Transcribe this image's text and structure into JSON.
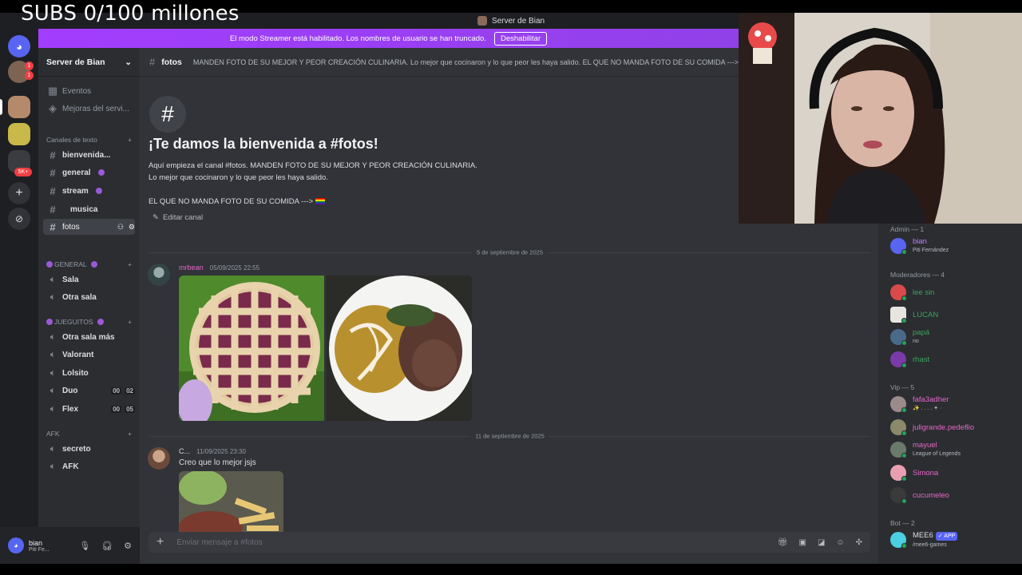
{
  "overlay": {
    "title": "SUBS 0/100 millones"
  },
  "window": {
    "title": "Server de Bian"
  },
  "streamer_bar": {
    "message": "El modo Streamer está habilitado. Los nombres de usuario se han truncado.",
    "button": "Deshabilitar"
  },
  "rail": {
    "badge_1": "1",
    "badge_2": "1",
    "badge_3": "5K+"
  },
  "server": {
    "name": "Server de Bian"
  },
  "sidebar": {
    "top_items": [
      "Eventos",
      "Mejoras del servi..."
    ],
    "text_category": "Canales de texto",
    "text_channels": [
      "bienvenida...",
      "general",
      "stream",
      "musica",
      "fotos"
    ],
    "cat_general": "GENERAL",
    "general_voice": [
      "Sala",
      "Otra sala"
    ],
    "cat_jueguitos": "JUEGUITOS",
    "jueguitos_voice": [
      "Otra sala más",
      "Valorant",
      "Lolsito",
      "Duo",
      "Flex"
    ],
    "duo_counts": [
      "00",
      "02"
    ],
    "flex_counts": [
      "00",
      "05"
    ],
    "cat_afk": "AFK",
    "afk_voice": [
      "secreto",
      "AFK"
    ]
  },
  "user_panel": {
    "name": "bian",
    "status": "Piti Fe..."
  },
  "channel": {
    "name": "fotos",
    "topic": "MANDEN FOTO DE SU MEJOR Y PEOR CREACIÓN CULINARIA. Lo mejor que cocinaron y lo que peor les haya salido. EL QUE NO MANDA FOTO DE SU COMIDA --->"
  },
  "welcome": {
    "hash": "#",
    "title": "¡Te damos la bienvenida a #fotos!",
    "line1": "Aquí empieza el canal #fotos. MANDEN FOTO DE SU MEJOR Y PEOR CREACIÓN CULINARIA.",
    "line2": "Lo mejor que cocinaron y lo que peor les haya salido.",
    "line3": "EL QUE NO MANDA FOTO DE SU COMIDA --->",
    "edit": "Editar canal"
  },
  "messages": [
    {
      "date": "5 de septiembre de 2025",
      "author": "mrbean",
      "timestamp": "05/09/2025 22:55"
    },
    {
      "date": "11 de septiembre de 2025",
      "author": "C...",
      "timestamp": "11/09/2025 23:30",
      "text": "Creo que lo mejor jsjs"
    }
  ],
  "composer": {
    "placeholder": "Enviar mensaje a #fotos"
  },
  "members": {
    "admin_label": "Admin — 1",
    "admin": [
      {
        "name": "bian",
        "activity": "Piti Fernández",
        "color": "#c77dff"
      }
    ],
    "mods_label": "Moderadores — 4",
    "mods": [
      {
        "name": "lee sin",
        "activity": "",
        "color": "#3ba55c"
      },
      {
        "name": "LUCAN",
        "activity": "",
        "color": "#3ba55c"
      },
      {
        "name": "papá",
        "activity": "no",
        "color": "#3ba55c"
      },
      {
        "name": "rhast",
        "activity": "",
        "color": "#3ba55c"
      }
    ],
    "vip_label": "Vip — 5",
    "vips": [
      {
        "name": "fafa3adher",
        "activity": "✨ .  .  .  .  ✦  ·",
        "color": "#e667c8"
      },
      {
        "name": "juligrande.pedeflio",
        "activity": "",
        "color": "#e667c8"
      },
      {
        "name": "mayuel",
        "activity": "League of Legends",
        "color": "#e667c8"
      },
      {
        "name": "Simona",
        "activity": "",
        "color": "#e667c8"
      },
      {
        "name": "cucumeleo",
        "activity": "",
        "color": "#e667c8"
      }
    ],
    "bot_label": "Bot — 2",
    "bots": [
      {
        "name": "MEE6",
        "badge": "✓ APP",
        "activity": "/mee6-games",
        "color": "#dbdee1"
      }
    ]
  }
}
